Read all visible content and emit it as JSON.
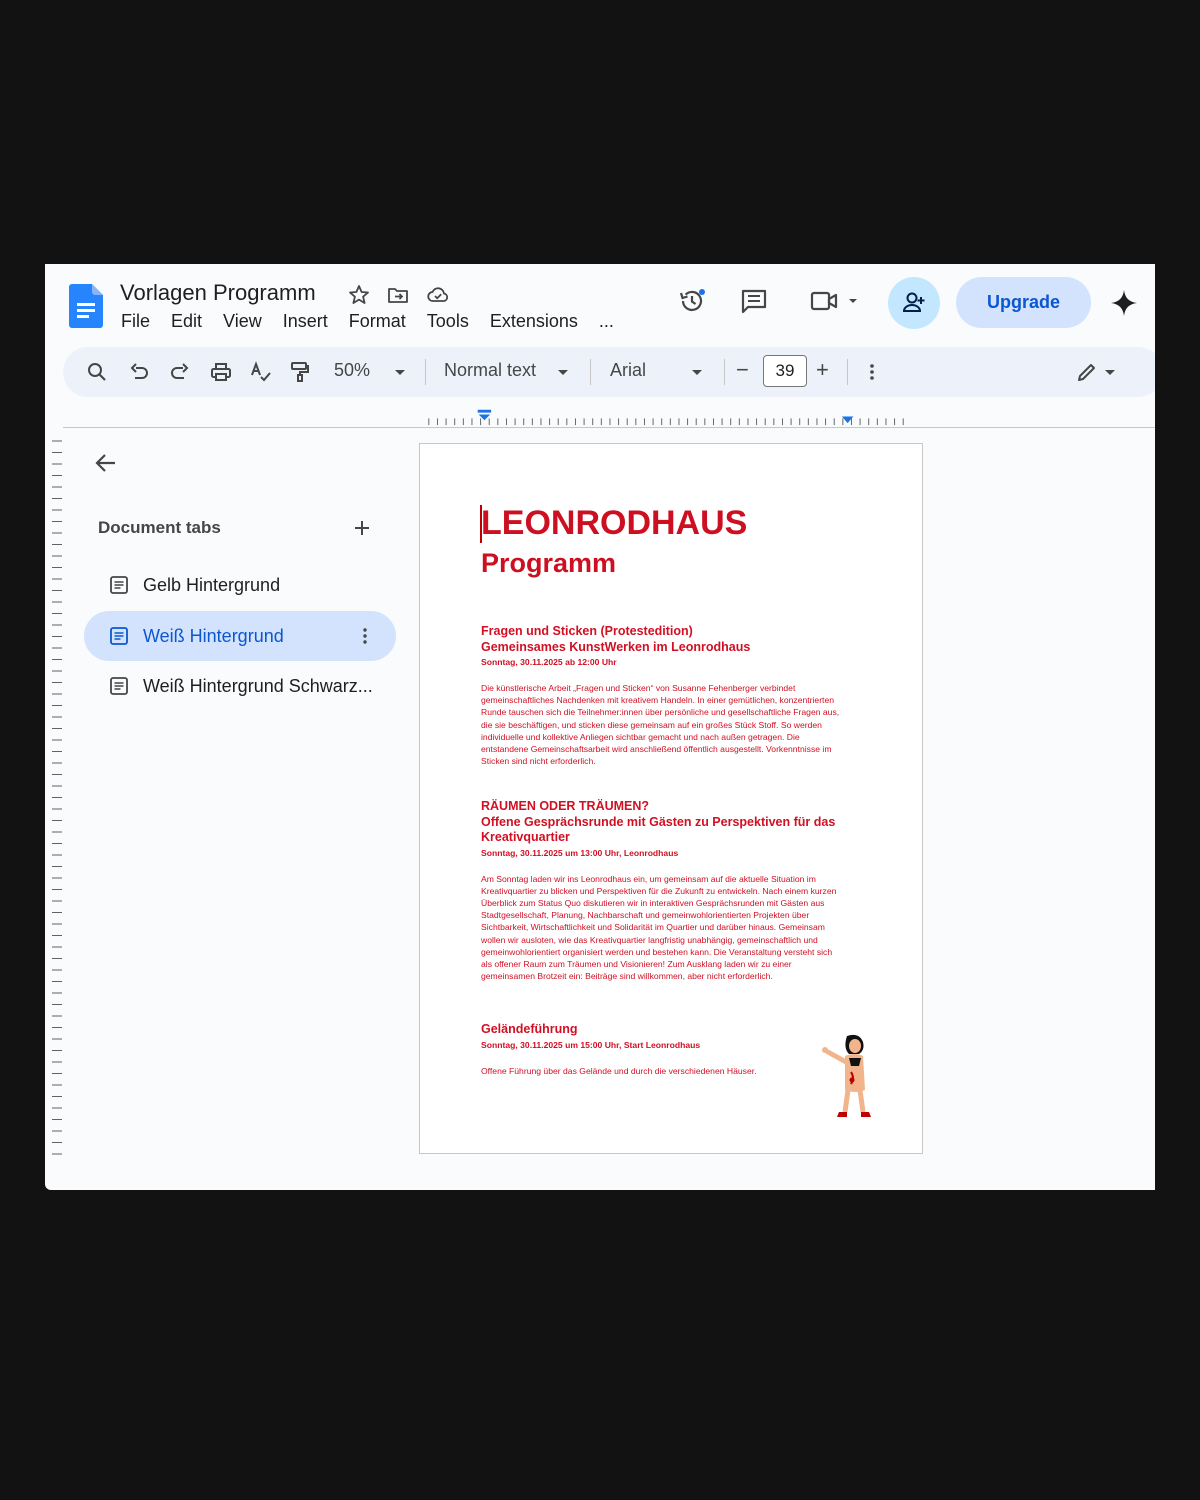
{
  "app": {
    "title": "Vorlagen Programm",
    "menu": [
      "File",
      "Edit",
      "View",
      "Insert",
      "Format",
      "Tools",
      "Extensions",
      "..."
    ],
    "upgrade_label": "Upgrade",
    "brand_color": "#0b57d0"
  },
  "toolbar": {
    "zoom": "50%",
    "style": "Normal text",
    "font": "Arial",
    "font_size": "39",
    "minus": "−",
    "plus": "+"
  },
  "sidebar": {
    "header": "Document tabs",
    "tabs": [
      {
        "label": "Gelb Hintergrund",
        "active": false
      },
      {
        "label": "Weiß Hintergrund",
        "active": true
      },
      {
        "label": "Weiß Hintergrund Schwarz...",
        "active": false
      }
    ]
  },
  "document": {
    "title": "LEONRODHAUS",
    "subtitle": "Programm",
    "accent_color": "#cc1021",
    "sections": [
      {
        "heading": [
          "Fragen und Sticken (Protestedition)",
          "Gemeinsames KunstWerken im Leonrodhaus"
        ],
        "date": "Sonntag, 30.11.2025 ab 12:00 Uhr",
        "body": "Die künstlerische Arbeit „Fragen und Sticken“ von Susanne Fehenberger verbindet gemeinschaftliches Nachdenken mit kreativem Handeln. In einer gemütlichen, konzentrierten Runde tauschen sich die Teilnehmer:innen über persönliche und gesellschaftliche Fragen aus, die sie beschäftigen, und sticken diese gemeinsam auf ein großes Stück Stoff. So werden individuelle und kollektive Anliegen sichtbar gemacht und nach außen getragen. Die entstandene Gemeinschaftsarbeit wird anschließend öffentlich ausgestellt. Vorkenntnisse im Sticken sind nicht erforderlich."
      },
      {
        "heading": [
          "RÄUMEN ODER TRÄUMEN?",
          "Offene Gesprächsrunde mit Gästen zu Perspektiven für das Kreativquartier"
        ],
        "date": "Sonntag, 30.11.2025 um 13:00 Uhr, Leonrodhaus",
        "body": "Am Sonntag laden wir ins Leonrodhaus ein, um gemeinsam auf die aktuelle Situation im Kreativquartier zu blicken und Perspektiven für die Zukunft zu entwickeln. Nach einem kurzen Überblick zum Status Quo diskutieren wir in interaktiven Gesprächsrunden mit Gästen aus Stadtgesellschaft, Planung, Nachbarschaft und gemeinwohlorientierten Projekten über Sichtbarkeit, Wirtschaftlichkeit und Solidarität im Quartier und darüber hinaus. Gemeinsam wollen wir ausloten, wie das Kreativquartier langfristig unabhängig, gemeinschaftlich und gemeinwohlorientiert organisiert werden und bestehen kann. Die Veranstaltung versteht sich als offener Raum zum Träumen und Visionieren! Zum Ausklang laden wir zu einer gemeinsamen Brotzeit ein: Beiträge sind willkommen, aber nicht erforderlich."
      },
      {
        "heading": [
          "Geländeführung"
        ],
        "date": "Sonntag, 30.11.2025 um 15:00 Uhr, Start Leonrodhaus",
        "body": "Offene Führung über das Gelände und durch die verschiedenen Häuser."
      }
    ]
  }
}
